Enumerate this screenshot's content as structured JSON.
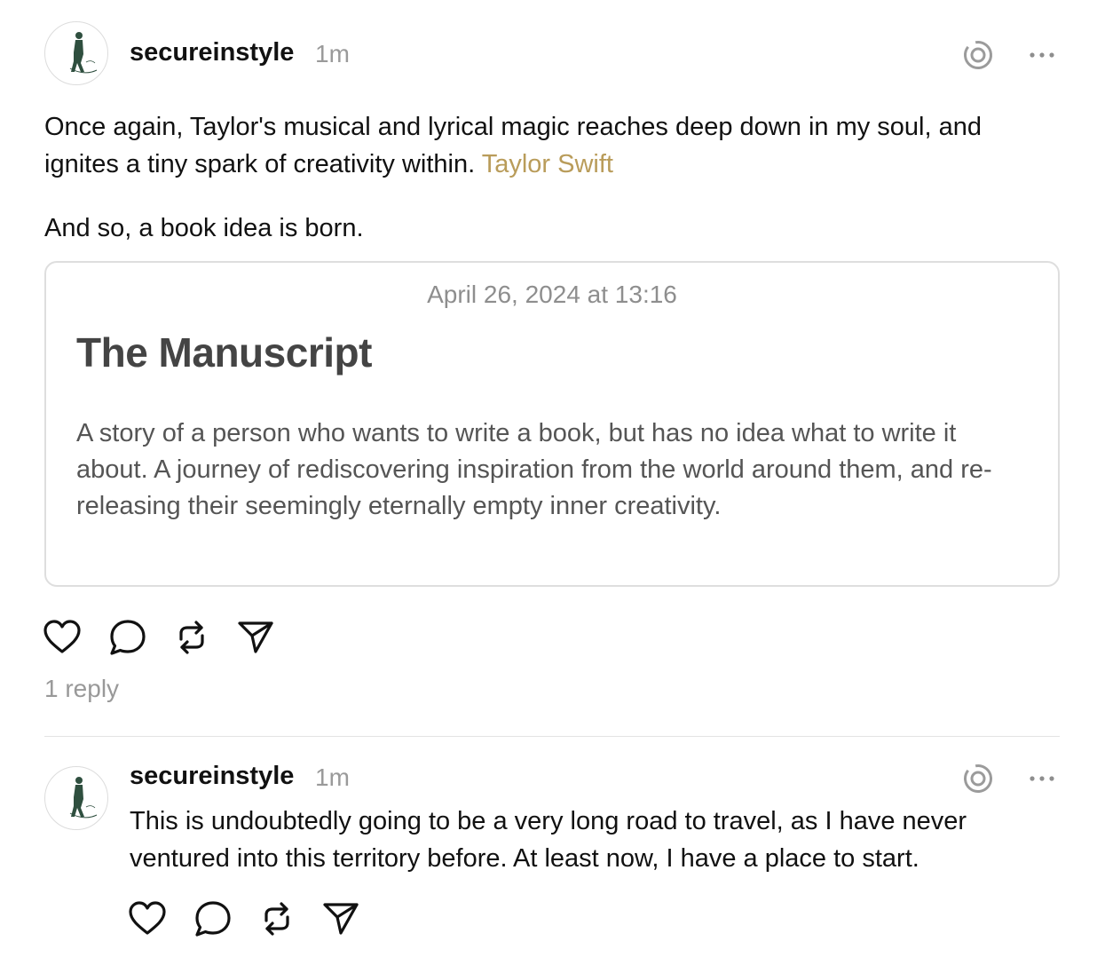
{
  "post": {
    "username": "secureinstyle",
    "time": "1m",
    "text_line1": "Once again, Taylor's musical and lyrical magic reaches deep down in my soul, and",
    "text_line2": "ignites a tiny spark of creativity within.",
    "mention": "Taylor Swift",
    "text_paragraph2": "And so, a book idea is born.",
    "attachment": {
      "date": "April 26, 2024 at 13:16",
      "title": "The Manuscript",
      "body": "A story of a person who wants to write a book, but has no idea what to write it about. A journey of rediscovering inspiration from the world around them, and re-releasing their seemingly eternally empty inner creativity."
    },
    "reply_count": "1 reply"
  },
  "reply": {
    "username": "secureinstyle",
    "time": "1m",
    "text": "This is undoubtedly going to be a very long road to travel, as I have never ventured into this territory before. At least now, I have a place to start."
  },
  "icons": [
    "avatar",
    "threads-activity-icon",
    "more-options-icon",
    "like-heart-icon",
    "comment-bubble-icon",
    "repost-icon",
    "share-send-icon"
  ],
  "colors": {
    "mention": "#b99c5a",
    "muted": "#9a9a9a",
    "border": "#dedede",
    "card_title": "#444444",
    "card_body": "#555555"
  }
}
